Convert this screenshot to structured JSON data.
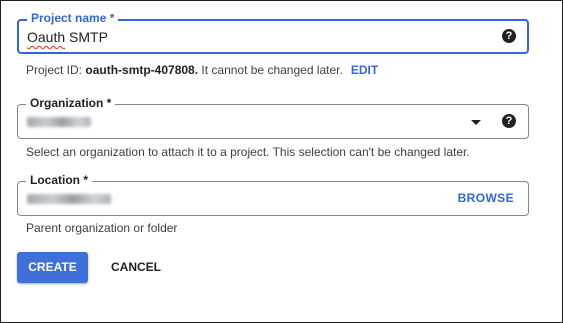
{
  "project_name": {
    "label": "Project name *",
    "value": "Oauth SMTP",
    "help_icon": "help-icon"
  },
  "project_id_hint": {
    "prefix": "Project ID: ",
    "id_value": "oauth-smtp-407808.",
    "suffix": " It cannot be changed later.",
    "edit_label": "EDIT"
  },
  "organization": {
    "label": "Organization *",
    "dropdown_icon": "chevron-down-icon",
    "help_icon": "help-icon",
    "hint": "Select an organization to attach it to a project. This selection can't be changed later."
  },
  "location": {
    "label": "Location *",
    "browse_label": "BROWSE",
    "hint": "Parent organization or folder"
  },
  "actions": {
    "create_label": "CREATE",
    "cancel_label": "CANCEL"
  },
  "colors": {
    "accent": "#3367d6",
    "create_bg": "#3f6fd8",
    "text": "#202124"
  }
}
